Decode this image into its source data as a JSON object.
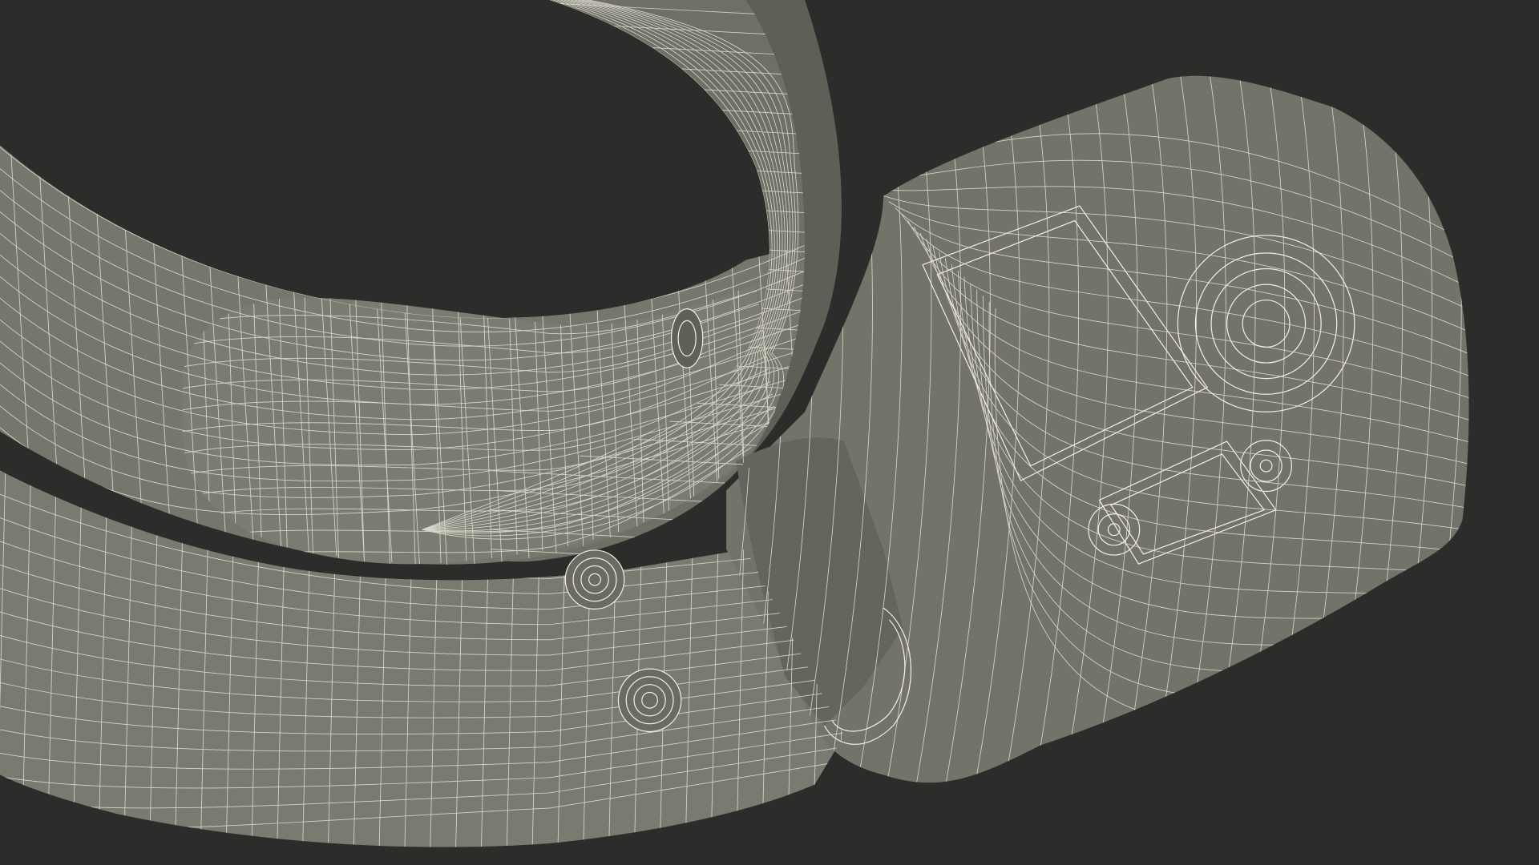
{
  "scene": {
    "background_color": "#2c2c2a",
    "surface_color": "#76766c",
    "surface_shadow_color": "#4a4a44",
    "wire_color": "#e8e6da",
    "render_style": "wireframe-over-shaded",
    "subject": "belt-with-buckle-3d-model"
  }
}
